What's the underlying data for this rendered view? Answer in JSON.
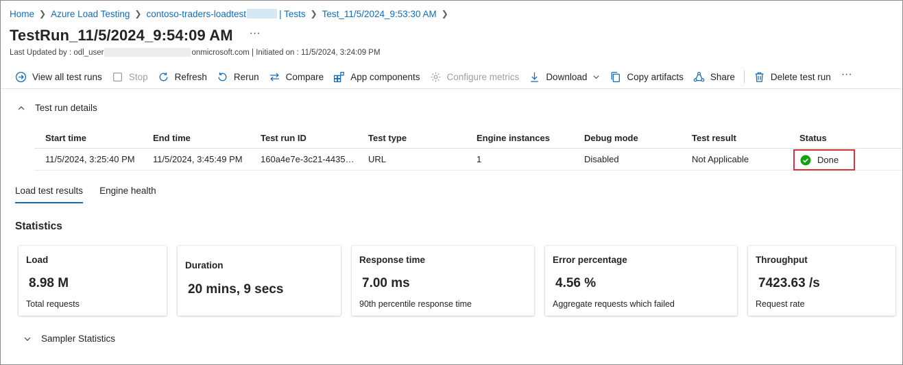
{
  "breadcrumb": {
    "home": "Home",
    "service": "Azure Load Testing",
    "resource": "contoso-traders-loadtest",
    "tests": "| Tests",
    "test": "Test_11/5/2024_9:53:30 AM"
  },
  "page": {
    "title": "TestRun_11/5/2024_9:54:09 AM",
    "more": "···",
    "subtitle_prefix": "Last Updated by : odl_user",
    "subtitle_suffix": "onmicrosoft.com | Initiated on : 11/5/2024, 3:24:09 PM"
  },
  "toolbar": {
    "view_all": "View all test runs",
    "stop": "Stop",
    "refresh": "Refresh",
    "rerun": "Rerun",
    "compare": "Compare",
    "app_components": "App components",
    "configure_metrics": "Configure metrics",
    "download": "Download",
    "copy_artifacts": "Copy artifacts",
    "share": "Share",
    "delete": "Delete test run",
    "more": "···"
  },
  "details": {
    "section_label": "Test run details",
    "columns": [
      "Start time",
      "End time",
      "Test run ID",
      "Test type",
      "Engine instances",
      "Debug mode",
      "Test result",
      "Status"
    ],
    "row": {
      "start": "11/5/2024, 3:25:40 PM",
      "end": "11/5/2024, 3:45:49 PM",
      "run_id": "160a4e7e-3c21-4435…",
      "type": "URL",
      "engines": "1",
      "debug": "Disabled",
      "result": "Not Applicable",
      "status": "Done"
    },
    "status_color": "#13a10e"
  },
  "tabs": [
    {
      "label": "Load test results",
      "active": true
    },
    {
      "label": "Engine health",
      "active": false
    }
  ],
  "statistics": {
    "title": "Statistics",
    "cards": [
      {
        "label": "Load",
        "value": "8.98 M",
        "sub": "Total requests"
      },
      {
        "label": "Duration",
        "value": "20 mins, 9 secs",
        "sub": ""
      },
      {
        "label": "Response time",
        "value": "7.00 ms",
        "sub": "90th percentile response time"
      },
      {
        "label": "Error percentage",
        "value": "4.56 %",
        "sub": "Aggregate requests which failed"
      },
      {
        "label": "Throughput",
        "value": "7423.63 /s",
        "sub": "Request rate"
      }
    ]
  },
  "sampler": {
    "label": "Sampler Statistics"
  },
  "colors": {
    "accent": "#0f6cbd",
    "highlight_border": "#d9303c",
    "disabled": "#a19f9d"
  }
}
